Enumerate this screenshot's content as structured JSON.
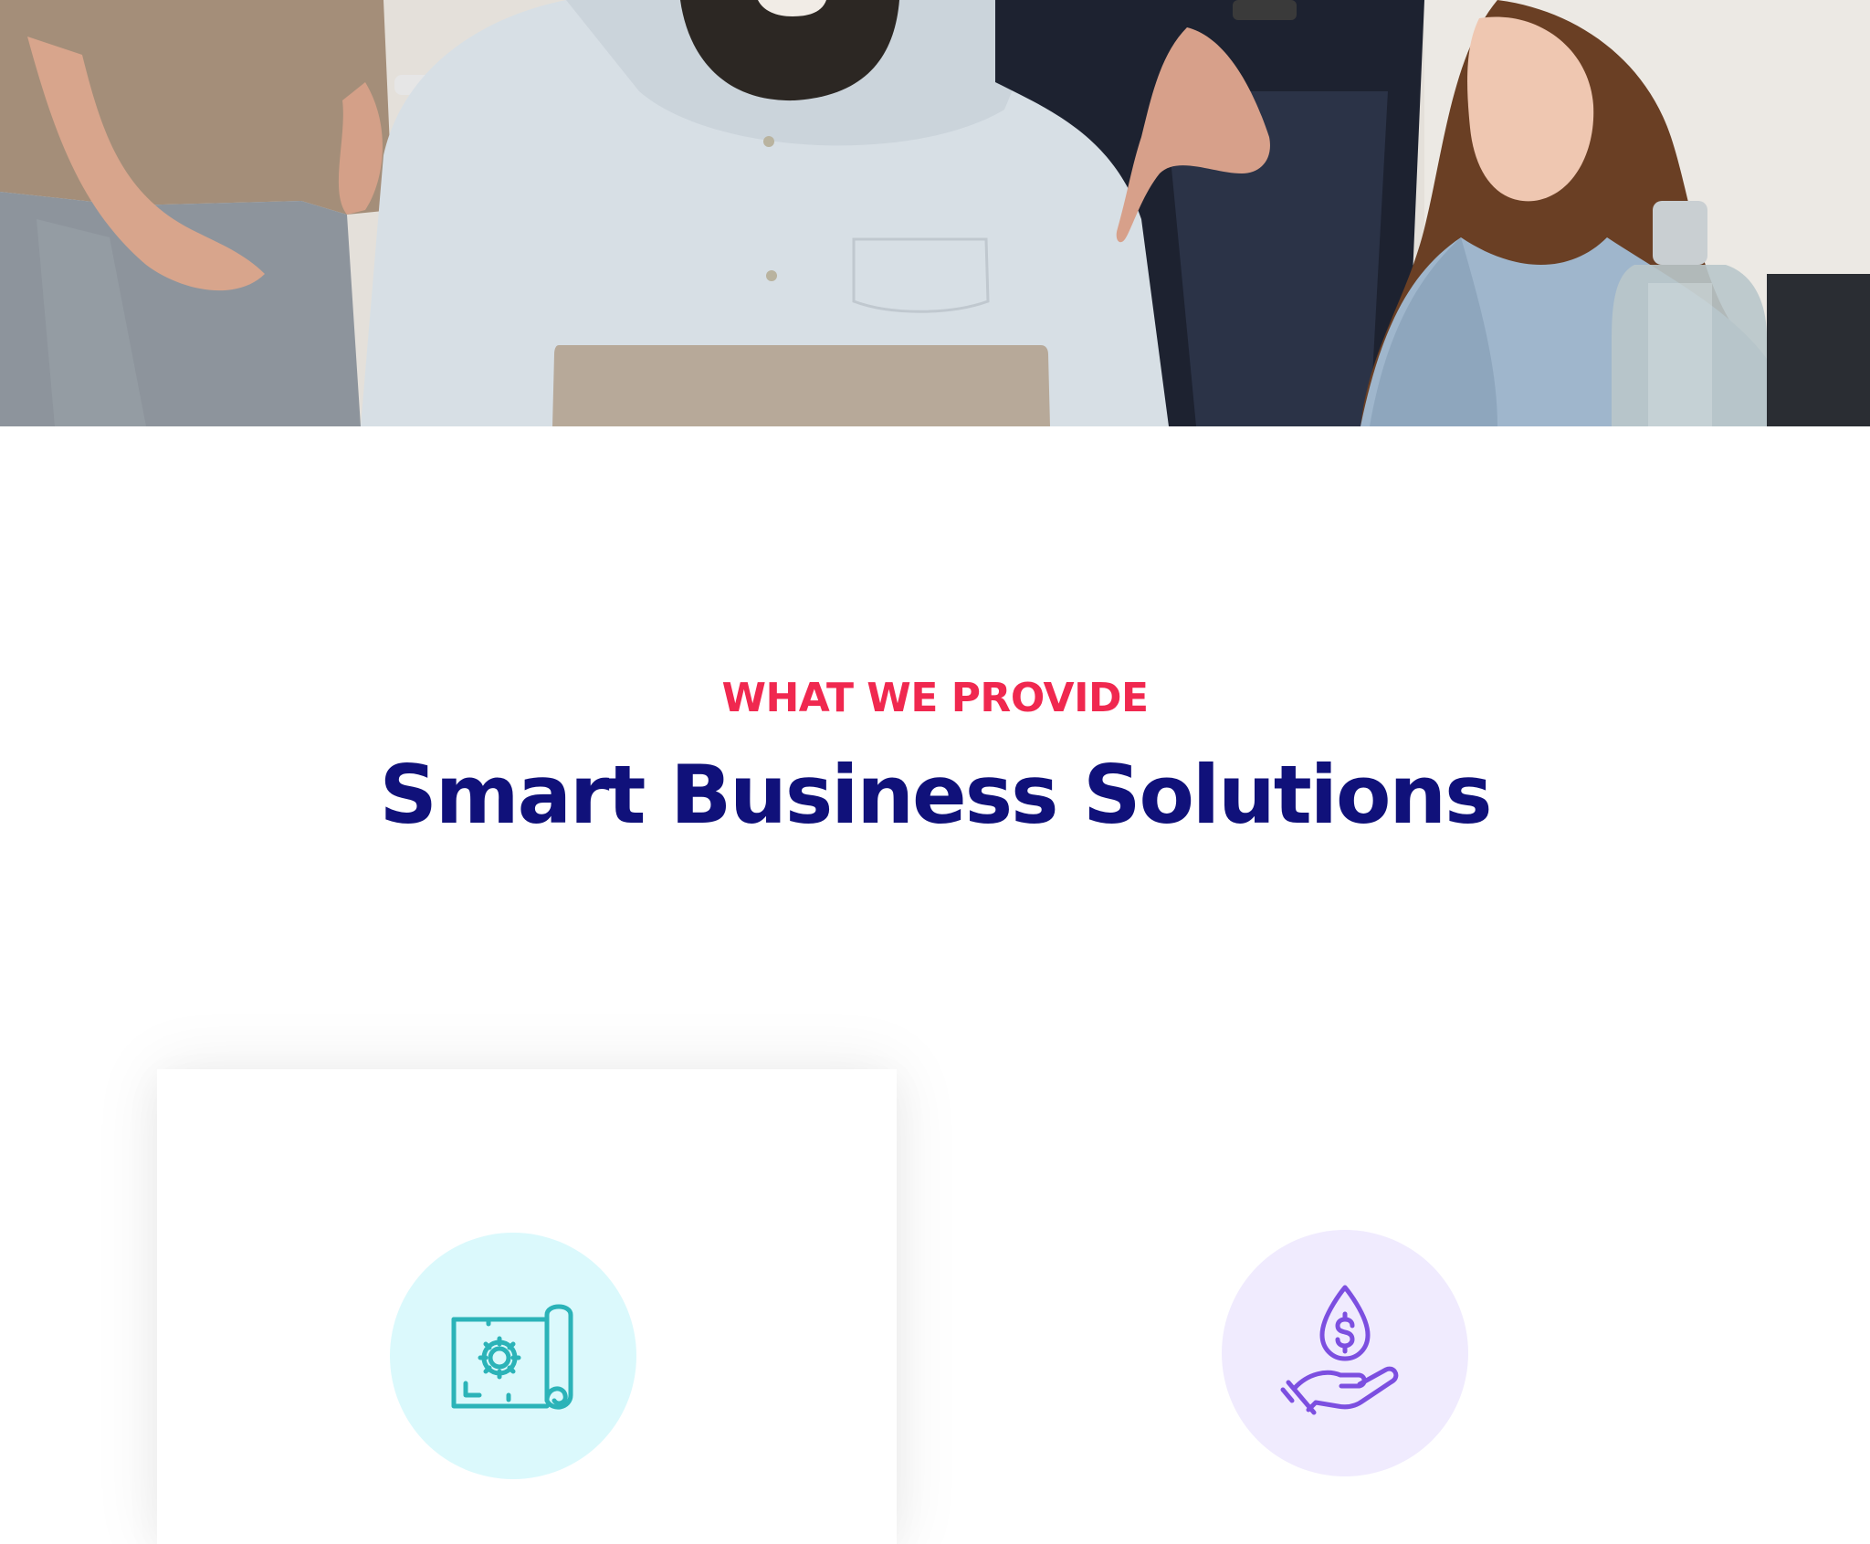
{
  "hero": {
    "image": "team-meeting-photo"
  },
  "section": {
    "eyebrow": "WHAT WE PROVIDE",
    "title": "Smart Business Solutions"
  },
  "services": [
    {
      "icon": "blueprint-gear-icon",
      "accent": "#2bb3b8",
      "bg": "#dbf9fc"
    },
    {
      "icon": "hand-money-drop-icon",
      "accent": "#7c4fe0",
      "bg": "#f0ebfe"
    }
  ],
  "colors": {
    "eyebrow": "#f0284f",
    "title": "#10117a"
  }
}
